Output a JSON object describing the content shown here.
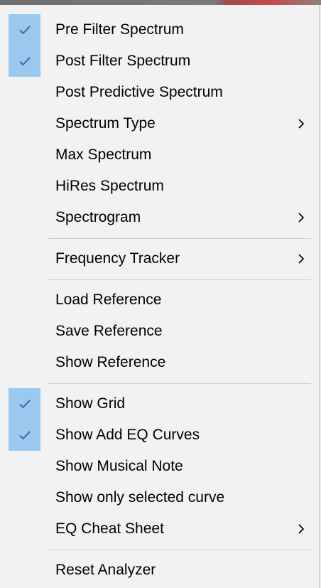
{
  "menu": {
    "items": [
      {
        "label": "Pre Filter Spectrum",
        "checked": true,
        "submenu": false
      },
      {
        "label": "Post Filter Spectrum",
        "checked": true,
        "submenu": false
      },
      {
        "label": "Post Predictive Spectrum",
        "checked": false,
        "submenu": false
      },
      {
        "label": "Spectrum Type",
        "checked": false,
        "submenu": true
      },
      {
        "label": "Max Spectrum",
        "checked": false,
        "submenu": false
      },
      {
        "label": "HiRes Spectrum",
        "checked": false,
        "submenu": false
      },
      {
        "label": "Spectrogram",
        "checked": false,
        "submenu": true
      },
      {
        "label": "Frequency Tracker",
        "checked": false,
        "submenu": true
      },
      {
        "label": "Load Reference",
        "checked": false,
        "submenu": false
      },
      {
        "label": "Save Reference",
        "checked": false,
        "submenu": false
      },
      {
        "label": "Show Reference",
        "checked": false,
        "submenu": false
      },
      {
        "label": "Show Grid",
        "checked": true,
        "submenu": false
      },
      {
        "label": "Show Add EQ Curves",
        "checked": true,
        "submenu": false
      },
      {
        "label": "Show Musical Note",
        "checked": false,
        "submenu": false
      },
      {
        "label": "Show only selected curve",
        "checked": false,
        "submenu": false
      },
      {
        "label": "EQ Cheat Sheet",
        "checked": false,
        "submenu": true
      },
      {
        "label": "Reset Analyzer",
        "checked": false,
        "submenu": false
      }
    ]
  },
  "colors": {
    "menu_background": "#f2f2f2",
    "check_highlight": "#99c9ef",
    "check_mark": "#3a6ea5",
    "separator": "#cfcfcf",
    "text": "#000000"
  },
  "icons": {
    "check": "checkmark-icon",
    "submenu": "chevron-right-icon"
  }
}
